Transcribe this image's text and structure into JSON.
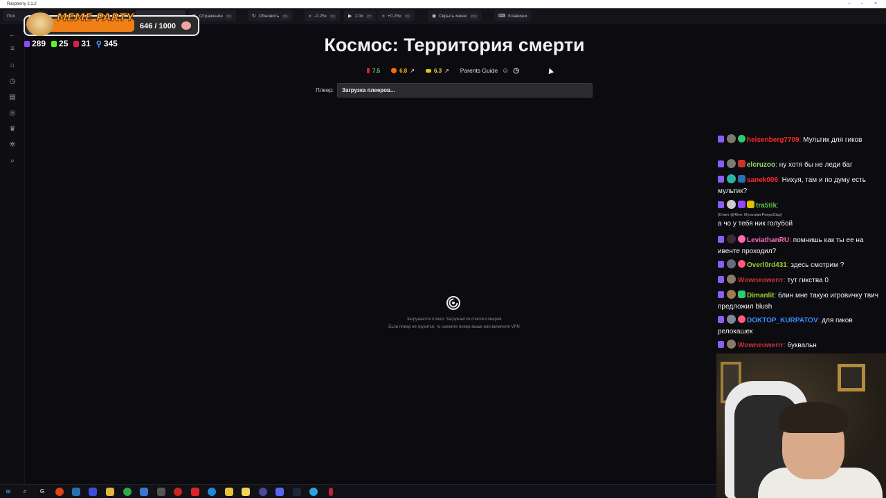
{
  "window": {
    "title": "Raspberry 2.1.2",
    "minimize": "–",
    "maximize": "▫",
    "close": "×"
  },
  "toolbar": {
    "tab_partial": "Пол",
    "mirror": {
      "label": "Отражение",
      "key": "F6"
    },
    "refresh": {
      "label": "Обновить",
      "key": "F5"
    },
    "slower": {
      "label": "-0.25x",
      "key": "F6"
    },
    "speed": {
      "label": "1.0x",
      "key": "F7"
    },
    "faster": {
      "label": "+0.25x",
      "key": "F8"
    },
    "hide_menu": {
      "label": "Скрыть меню",
      "key": "F10"
    },
    "keys": {
      "label": "Клавиши"
    }
  },
  "sidebar": {
    "items": [
      "back-icon",
      "menu-icon",
      "home-icon",
      "history-icon",
      "catalog-icon",
      "random-icon",
      "trophy-icon",
      "settings-icon",
      "search-icon"
    ]
  },
  "overlay": {
    "title": "MEME PARTY",
    "progress_value": 646,
    "progress_max": 1000,
    "progress_text": "646 / 1000",
    "stats": [
      {
        "icon": "twitch-icon",
        "value": "289",
        "color": "#9146ff"
      },
      {
        "icon": "kick-icon",
        "value": "25",
        "color": "#53fc18"
      },
      {
        "icon": "vk-icon",
        "value": "31",
        "color": "#e01c4f"
      },
      {
        "icon": "viewers-icon",
        "value": "345",
        "color": "#4aa3ff"
      }
    ]
  },
  "movie": {
    "title": "Космос: Территория смерти",
    "ratings": [
      {
        "source": "imdb",
        "value": "7.5",
        "color": "#6dd66d",
        "badge": "#e02020"
      },
      {
        "source": "kinopoisk",
        "value": "6.8",
        "color": "#ffb300",
        "badge": "#ff6a00"
      },
      {
        "source": "shikimori",
        "value": "6.3",
        "color": "#ffd43b",
        "badge": "#e8c400"
      }
    ],
    "parents_guide": "Parents Guide"
  },
  "player": {
    "label": "Плеер:",
    "selected": "Загрузка плееров...",
    "loading_line1": "Загружается плеер: Загружается список плееров",
    "loading_line2": "Если плеер не грузится, то смените плеер выше или включите VPN"
  },
  "chat": {
    "messages": [
      {
        "nick": "heisenberg7709",
        "nick_color": "#ff2b2b",
        "text": "Мультик для гиков"
      },
      {
        "nick": "elcruzoo",
        "nick_color": "#9be06a",
        "text": "ну хотя бы не леди баг"
      },
      {
        "nick": "sanek006",
        "nick_color": "#ff2b2b",
        "text": "Нихуя, там и по думу есть мультик?"
      },
      {
        "nick": "tra5tik",
        "nick_color": "#5cc24a",
        "reply": "[Ответ @4live: Мультики PeepoClap]",
        "text": "а чо у тебя ник голубой"
      },
      {
        "nick": "LeviathanRU",
        "nick_color": "#ff69b4",
        "text": "помнишь как ты ее на ивенте проходил?"
      },
      {
        "nick": "Overl0rd431",
        "nick_color": "#9acd32",
        "text": "здесь смотрим ?"
      },
      {
        "nick": "Wowneowerrr",
        "nick_color": "#c83232",
        "text": "тут гикства 0"
      },
      {
        "nick": "Dimanlit",
        "nick_color": "#9acd32",
        "text": "блин мне такую игровичку твич предложил blush"
      },
      {
        "nick": "DOKTOP_KURPATOV",
        "nick_color": "#3c8cff",
        "text": "для гиков релокашек"
      },
      {
        "nick": "Wowneowerrr",
        "nick_color": "#c83232",
        "text": "буквальн"
      }
    ]
  },
  "taskbar": {
    "icons": [
      "windows-icon",
      "search-icon",
      "g-hub-icon",
      "app-icon",
      "file-icon",
      "app2-icon",
      "folder-icon",
      "chrome-icon",
      "app3-icon",
      "app4-icon",
      "app5-icon",
      "app6-icon",
      "app7-icon",
      "app8-icon",
      "app9-icon",
      "app10-icon",
      "discord-icon",
      "steam-icon",
      "telegram-icon",
      "gear-icon",
      "raspberry-icon"
    ]
  }
}
